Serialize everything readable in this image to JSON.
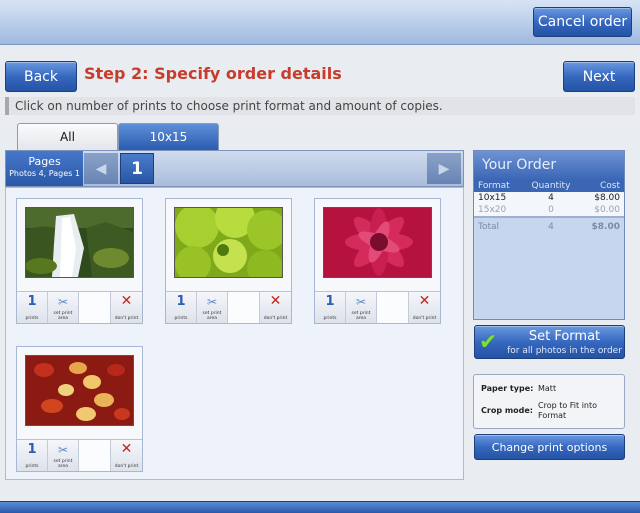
{
  "header": {
    "cancel_label": "Cancel order"
  },
  "nav": {
    "back_label": "Back",
    "next_label": "Next",
    "title": "Step 2: Specify order details"
  },
  "hint": "Click on number of prints to choose print format and amount of copies.",
  "tabs": [
    {
      "label": "All",
      "active": false
    },
    {
      "label": "10x15",
      "active": true
    }
  ],
  "pages": {
    "label": "Pages",
    "sub": "Photos 4, Pages 1",
    "current": "1"
  },
  "photos": [
    {
      "name": "waterfall",
      "prints": "1",
      "prints_label": "prints",
      "area_label": "set print area",
      "dont_label": "don't print"
    },
    {
      "name": "green-succulent",
      "prints": "1",
      "prints_label": "prints",
      "area_label": "set print area",
      "dont_label": "don't print"
    },
    {
      "name": "pink-dahlia",
      "prints": "1",
      "prints_label": "prints",
      "area_label": "set print area",
      "dont_label": "don't print"
    },
    {
      "name": "autumn-leaves",
      "prints": "1",
      "prints_label": "prints",
      "area_label": "set print area",
      "dont_label": "don't print"
    }
  ],
  "order": {
    "title": "Your Order",
    "headers": [
      "Format",
      "Quantity",
      "Cost"
    ],
    "rows": [
      {
        "format": "10x15",
        "qty": "4",
        "cost": "$8.00"
      },
      {
        "format": "15x20",
        "qty": "0",
        "cost": "$0.00"
      }
    ],
    "total": {
      "label": "Total",
      "qty": "4",
      "cost": "$8.00"
    }
  },
  "set_format": {
    "title": "Set Format",
    "sub": "for all photos in the order"
  },
  "print_info": {
    "paper_label": "Paper type:",
    "paper_value": "Matt",
    "crop_label": "Crop mode:",
    "crop_value": "Crop to Fit into Format"
  },
  "change_label": "Change print options",
  "colors": {
    "accent": "#2f62b8",
    "title_red": "#c73c2a",
    "delete_red": "#c0281e",
    "count_blue": "#2a5db3"
  }
}
